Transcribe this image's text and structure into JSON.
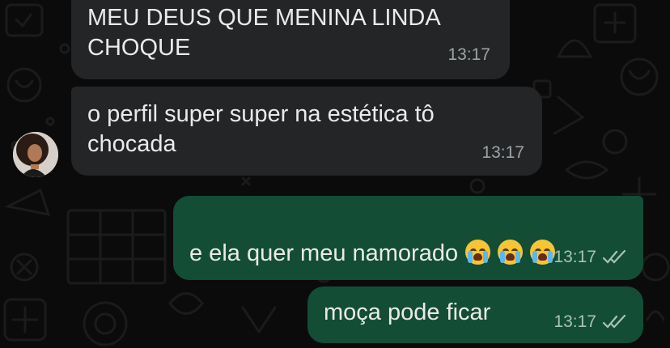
{
  "chat": {
    "messages": [
      {
        "direction": "incoming",
        "text": "MEU DEUS QUE MENINA LINDA\nCHOQUE",
        "time": "13:17"
      },
      {
        "direction": "incoming",
        "text": "o perfil super super na estética tô\nchocada",
        "time": "13:17"
      },
      {
        "direction": "outgoing",
        "text": "e ela quer meu namorado",
        "time": "13:17",
        "status": "read",
        "emojis": [
          "loudly-crying-face",
          "loudly-crying-face",
          "loudly-crying-face"
        ]
      },
      {
        "direction": "outgoing",
        "text": "moça pode ficar",
        "time": "13:17",
        "status": "read"
      }
    ]
  },
  "colors": {
    "background": "#0b0b0b",
    "incoming_bubble": "#232526",
    "outgoing_bubble": "#134d35",
    "read_ticks": "#a9c3b6"
  }
}
